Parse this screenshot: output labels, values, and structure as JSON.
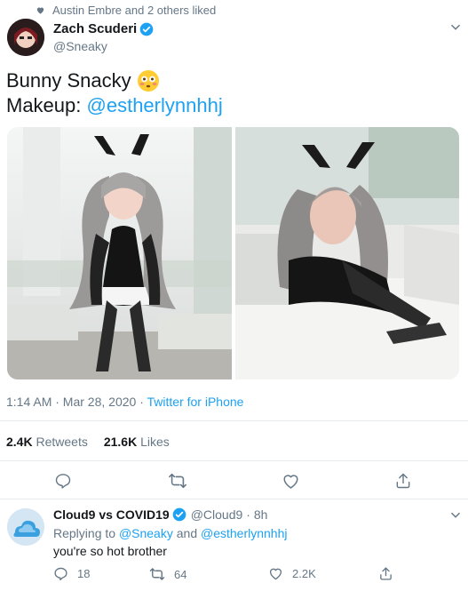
{
  "social_context": {
    "text": "Austin Embre and 2 others liked"
  },
  "author": {
    "name": "Zach Scuderi",
    "handle": "@Sneaky"
  },
  "tweet": {
    "line1": "Bunny Snacky",
    "line2_prefix": "Makeup:",
    "line2_mention": "@estherlynnhhj",
    "emoji": "flushed-face"
  },
  "meta": {
    "time": "1:14 AM · Mar 28, 2020 · ",
    "source": "Twitter for iPhone"
  },
  "stats": {
    "retweets_count": "2.4K",
    "retweets_label": "Retweets",
    "likes_count": "21.6K",
    "likes_label": "Likes"
  },
  "reply": {
    "name": "Cloud9 vs COVID19",
    "handle": "@Cloud9",
    "time": "· 8h",
    "replying_prefix": "Replying to",
    "replying_to1": "@Sneaky",
    "replying_and": "and",
    "replying_to2": "@estherlynnhhj",
    "text": "you're so hot brother",
    "reply_count": "18",
    "retweet_count": "64",
    "like_count": "2.2K"
  },
  "colors": {
    "accent": "#1da1f2",
    "muted": "#657786",
    "divider": "#e6ecf0"
  }
}
